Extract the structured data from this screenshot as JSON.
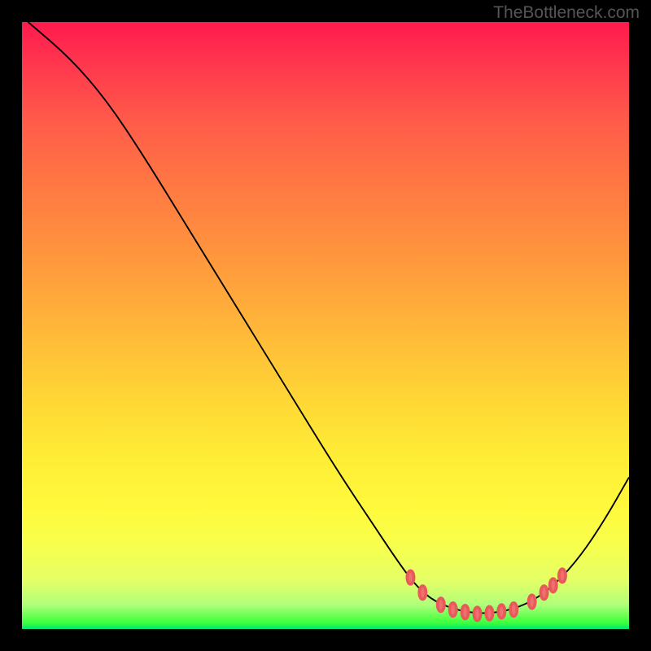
{
  "watermark": "TheBottleneck.com",
  "chart_data": {
    "type": "line",
    "title": "",
    "xlabel": "",
    "ylabel": "",
    "xlim": [
      0,
      100
    ],
    "ylim": [
      0,
      100
    ],
    "series": [
      {
        "name": "curve",
        "points": [
          {
            "x": 1,
            "y": 100
          },
          {
            "x": 8,
            "y": 94
          },
          {
            "x": 14,
            "y": 87
          },
          {
            "x": 20,
            "y": 78
          },
          {
            "x": 28,
            "y": 65
          },
          {
            "x": 36,
            "y": 52
          },
          {
            "x": 44,
            "y": 39
          },
          {
            "x": 52,
            "y": 26
          },
          {
            "x": 58,
            "y": 17
          },
          {
            "x": 62,
            "y": 11
          },
          {
            "x": 65,
            "y": 7
          },
          {
            "x": 68,
            "y": 4.5
          },
          {
            "x": 72,
            "y": 3
          },
          {
            "x": 76,
            "y": 2.5
          },
          {
            "x": 80,
            "y": 3
          },
          {
            "x": 84,
            "y": 4.5
          },
          {
            "x": 88,
            "y": 7.5
          },
          {
            "x": 92,
            "y": 12
          },
          {
            "x": 96,
            "y": 18
          },
          {
            "x": 100,
            "y": 25
          }
        ]
      }
    ],
    "markers": [
      {
        "x": 64,
        "y": 8.5
      },
      {
        "x": 66,
        "y": 6
      },
      {
        "x": 69,
        "y": 4
      },
      {
        "x": 71,
        "y": 3.2
      },
      {
        "x": 73,
        "y": 2.8
      },
      {
        "x": 75,
        "y": 2.5
      },
      {
        "x": 77,
        "y": 2.6
      },
      {
        "x": 79,
        "y": 2.9
      },
      {
        "x": 81,
        "y": 3.2
      },
      {
        "x": 84,
        "y": 4.5
      },
      {
        "x": 86,
        "y": 6
      },
      {
        "x": 87.5,
        "y": 7.2
      },
      {
        "x": 89,
        "y": 8.8
      }
    ],
    "gradient_colors": {
      "top": "#ff1a4d",
      "middle": "#ffed36",
      "bottom": "#00e676"
    }
  }
}
